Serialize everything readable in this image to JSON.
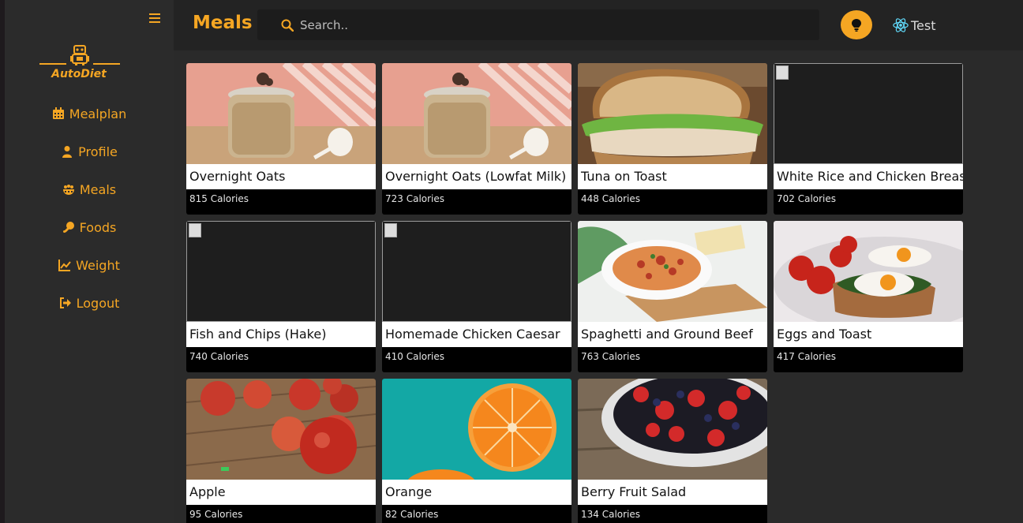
{
  "app": {
    "logo_text": "AutoDiet",
    "accent_color": "#f5a623"
  },
  "sidebar": {
    "items": [
      {
        "label": "Mealplan",
        "icon": "calendar-icon"
      },
      {
        "label": "Profile",
        "icon": "user-icon"
      },
      {
        "label": "Meals",
        "icon": "meals-icon"
      },
      {
        "label": "Foods",
        "icon": "drumstick-icon"
      },
      {
        "label": "Weight",
        "icon": "chart-line-icon"
      },
      {
        "label": "Logout",
        "icon": "logout-icon"
      }
    ]
  },
  "header": {
    "title": "Meals",
    "search_placeholder": "Search..",
    "user_name": "Test"
  },
  "meals": [
    {
      "name": "Overnight Oats",
      "calories": "815 Calories",
      "image": "oats-jar"
    },
    {
      "name": "Overnight Oats (Lowfat Milk)",
      "calories": "723 Calories",
      "image": "oats-jar"
    },
    {
      "name": "Tuna on Toast",
      "calories": "448 Calories",
      "image": "sandwich"
    },
    {
      "name": "White Rice and Chicken Breast",
      "calories": "702 Calories",
      "image": "broken"
    },
    {
      "name": "Fish and Chips (Hake)",
      "calories": "740 Calories",
      "image": "broken"
    },
    {
      "name": "Homemade Chicken Caesar",
      "calories": "410 Calories",
      "image": "broken"
    },
    {
      "name": "Spaghetti and Ground Beef",
      "calories": "763 Calories",
      "image": "spaghetti"
    },
    {
      "name": "Eggs and Toast",
      "calories": "417 Calories",
      "image": "eggs"
    },
    {
      "name": "Apple",
      "calories": "95 Calories",
      "image": "apples"
    },
    {
      "name": "Orange",
      "calories": "82 Calories",
      "image": "orange"
    },
    {
      "name": "Berry Fruit Salad",
      "calories": "134 Calories",
      "image": "berries"
    }
  ]
}
